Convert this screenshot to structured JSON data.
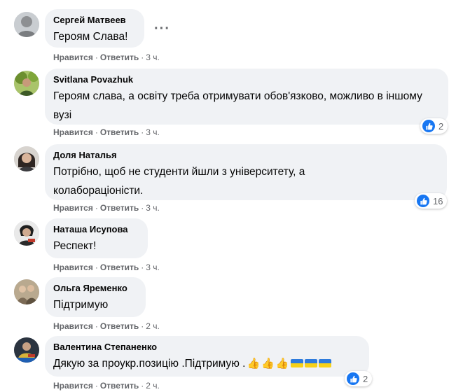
{
  "comments": [
    {
      "author": "Сергей Матвеев",
      "text": "Героям Слава!",
      "like": "Нравится",
      "reply": "Ответить",
      "time": "3 ч.",
      "avatar_color": "#9aa1a6"
    },
    {
      "author": "Svitlana Povazhuk",
      "text": "Героям слава, а освіту треба отримувати обов'язково, можливо в іншому вузі",
      "like": "Нравится",
      "reply": "Ответить",
      "time": "3 ч.",
      "reactions": "2",
      "avatar_color": "#6a8f3a"
    },
    {
      "author": "Доля Наталья",
      "text": "Потрібно, щоб не студенти йшли з університету, а колабораціоністи.",
      "like": "Нравится",
      "reply": "Ответить",
      "time": "3 ч.",
      "reactions": "16",
      "avatar_color": "#5a4f4a"
    },
    {
      "author": "Наташа Исупова",
      "text": "Респект!",
      "like": "Нравится",
      "reply": "Ответить",
      "time": "3 ч.",
      "avatar_color": "#3a3a3a"
    },
    {
      "author": "Ольга Яременко",
      "text": "Підтримую",
      "like": "Нравится",
      "reply": "Ответить",
      "time": "2 ч.",
      "avatar_color": "#8c7d66"
    },
    {
      "author": "Валентина Степаненко",
      "text": "Дякую за проукр.позицію .Підтримую .",
      "like": "Нравится",
      "reply": "Ответить",
      "time": "2 ч.",
      "reactions": "2",
      "avatar_color": "#2c3a4a"
    }
  ],
  "colors": {
    "like_blue": "#1877f2",
    "bubble_bg": "#f0f2f5",
    "meta_gray": "#65676b"
  },
  "icons": {
    "more": "more-options-icon",
    "like": "like-icon",
    "thumbs": "thumbs-up-emoji",
    "flag": "ukraine-flag-emoji"
  }
}
